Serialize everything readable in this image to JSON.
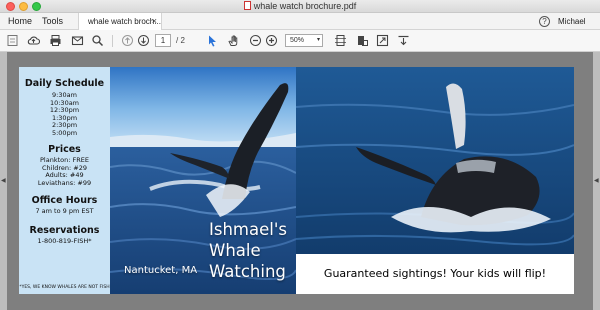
{
  "window": {
    "title": "whale watch brochure.pdf"
  },
  "tabs": {
    "home": "Home",
    "tools": "Tools",
    "document": "whale watch broch...",
    "close": "×"
  },
  "account": {
    "help": "?",
    "user": "Michael"
  },
  "toolbar": {
    "page_current": "1",
    "page_total": "/ 2",
    "zoom": "50%",
    "icons": [
      "create-pdf-icon",
      "cloud-upload-icon",
      "print-icon",
      "email-icon",
      "search-icon",
      "prev-page-icon",
      "next-page-icon",
      "select-cursor-icon",
      "hand-tool-icon",
      "zoom-out-icon",
      "zoom-in-icon",
      "fit-page-icon",
      "rotate-icon",
      "fullscreen-icon",
      "read-mode-icon"
    ]
  },
  "brochure": {
    "schedule_heading": "Daily Schedule",
    "schedule_times": [
      "9:30am",
      "10:30am",
      "12:30pm",
      "1:30pm",
      "2:30pm",
      "5:00pm"
    ],
    "prices_heading": "Prices",
    "prices": [
      "Plankton: FREE",
      "Children: #29",
      "Adults: #49",
      "Leviathans: #99"
    ],
    "hours_heading": "Office Hours",
    "hours": "7 am to 9 pm EST",
    "reservations_heading": "Reservations",
    "phone": "1-800-819-FISH*",
    "footnote": "*YES, WE KNOW WHALES ARE NOT FISH",
    "title_lines": [
      "Ishmael's",
      "Whale",
      "Watching"
    ],
    "location": "Nantucket, MA",
    "tagline": "Guaranteed sightings! Your kids will flip!"
  },
  "colors": {
    "panel_bg": "#c9e3f5",
    "sea": "#1e4f86",
    "active_tool": "#2a73d9"
  }
}
